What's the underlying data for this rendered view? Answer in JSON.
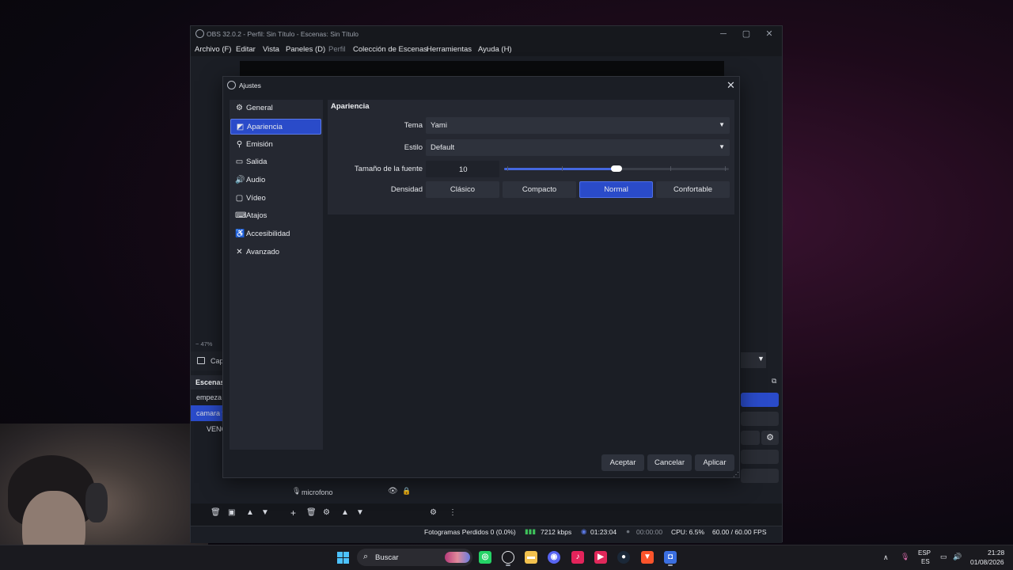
{
  "obs": {
    "title": "OBS 32.0.2 - Perfil: Sin Título - Escenas: Sin Título",
    "menu": [
      "Archivo (F)",
      "Editar",
      "Vista",
      "Paneles (D)",
      "Perfil",
      "Colección de Escenas",
      "Herramientas",
      "Ayuda (H)"
    ],
    "zoom": "47%",
    "capture_label": "Cap",
    "scenes_title": "Escenas",
    "scenes": [
      "empeza",
      "camara t",
      "VENG"
    ],
    "source_mic": "microfono",
    "status": {
      "dropped_frames": "Fotogramas Perdidos 0 (0.0%)",
      "bitrate": "7212 kbps",
      "rec_time": "01:23:04",
      "stream_time": "00:00:00",
      "cpu": "CPU: 6.5%",
      "fps": "60.00 / 60.00 FPS"
    }
  },
  "dialog": {
    "title": "Ajustes",
    "nav": [
      {
        "label": "General",
        "icon": "gear-icon",
        "glyph": "⚙"
      },
      {
        "label": "Apariencia",
        "icon": "appearance-icon",
        "glyph": "◩"
      },
      {
        "label": "Emisión",
        "icon": "broadcast-icon",
        "glyph": "⚲"
      },
      {
        "label": "Salida",
        "icon": "output-icon",
        "glyph": "▭"
      },
      {
        "label": "Audio",
        "icon": "speaker-icon",
        "glyph": "🔊"
      },
      {
        "label": "Vídeo",
        "icon": "monitor-icon",
        "glyph": "▢"
      },
      {
        "label": "Atajos",
        "icon": "keyboard-icon",
        "glyph": "⌨"
      },
      {
        "label": "Accesibilidad",
        "icon": "accessibility-icon",
        "glyph": "♿"
      },
      {
        "label": "Avanzado",
        "icon": "tools-icon",
        "glyph": "✕"
      }
    ],
    "selected_nav": "Apariencia",
    "section_title": "Apariencia",
    "theme_label": "Tema",
    "theme_value": "Yami",
    "style_label": "Estilo",
    "style_value": "Default",
    "font_size_label": "Tamaño de la fuente",
    "font_size_value": "10",
    "font_size_slider_fraction": 0.5,
    "density_label": "Densidad",
    "density_options": [
      "Clásico",
      "Compacto",
      "Normal",
      "Confortable"
    ],
    "density_selected": "Normal",
    "buttons": {
      "accept": "Aceptar",
      "cancel": "Cancelar",
      "apply": "Aplicar"
    }
  },
  "taskbar": {
    "search_text": "Buscar",
    "lang": "ESP",
    "lang_sub": "ES",
    "time": "21:28",
    "date": "01/08/2026"
  },
  "colors": {
    "accent": "#2a4bc9",
    "windows_blue": "#4cc2ff"
  }
}
